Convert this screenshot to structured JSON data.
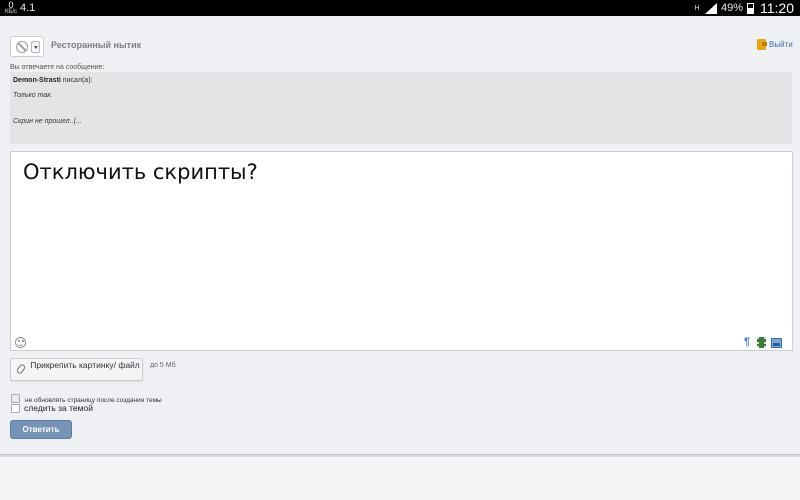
{
  "status_bar": {
    "network_small": "0",
    "network_unit": "КБ/с",
    "left_text": "4.1",
    "network_type": "H",
    "battery_percent": "49%",
    "time": "11:20",
    "icons": [
      "data-speed-icon",
      "signal-icon",
      "battery-icon"
    ]
  },
  "header": {
    "topic_title": "Ресторанный нытик",
    "exit_label": "Выйти",
    "icons": [
      "ban-icon",
      "chevron-down-icon",
      "exit-door-icon"
    ]
  },
  "reply": {
    "label": "Вы отвечаете на сообщение:",
    "author": "Demon-Strasti",
    "wrote": " писал(а):",
    "line1": "Только так.",
    "line2": "Скрин не прошел..(..."
  },
  "editor": {
    "text": "Отключить скрипты?",
    "icons": [
      "smiley-icon",
      "pilcrow-icon",
      "film-icon",
      "image-icon"
    ]
  },
  "attach": {
    "button_label": "Прикрепить картинку/ файл",
    "limit": "до 5 Мб"
  },
  "options": {
    "no_refresh_label": "не обновлять страницу после создания темы",
    "follow_label": "следить за темой"
  },
  "submit_label": "Ответить",
  "colors": {
    "page_bg": "#eef0f3",
    "quote_bg": "#e3e4e6",
    "submit_bg": "#7592b7",
    "link": "#3b6db0"
  }
}
